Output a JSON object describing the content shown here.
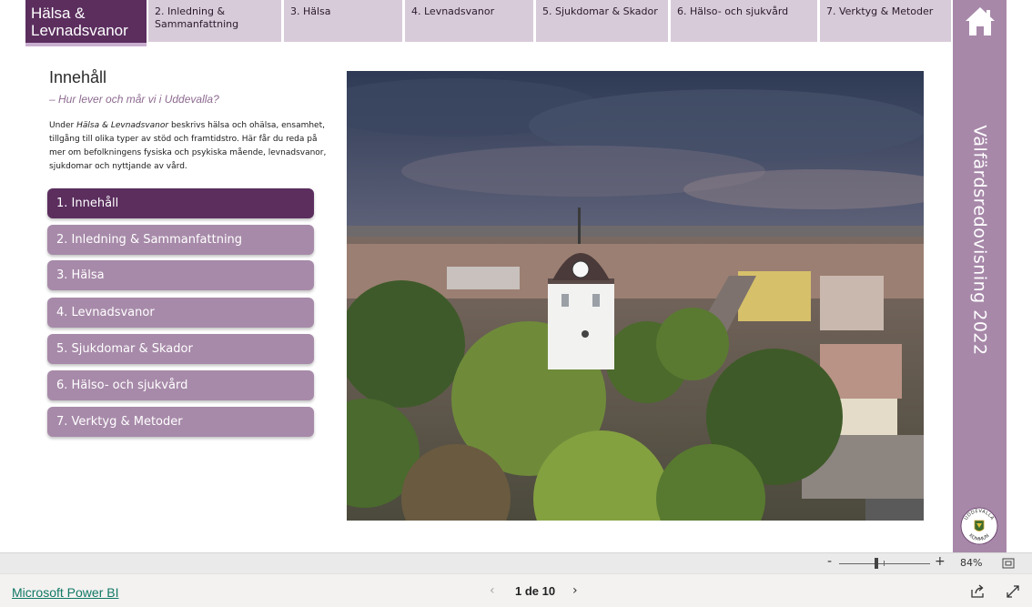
{
  "brand": {
    "line1": "Hälsa &",
    "line2": "Levnadsvanor"
  },
  "tabs": [
    {
      "line1": "2. Inledning &",
      "line2": "Sammanfattning"
    },
    {
      "line1": "3. Hälsa",
      "line2": ""
    },
    {
      "line1": "4. Levnadsvanor",
      "line2": ""
    },
    {
      "line1": "5. Sjukdomar & Skador",
      "line2": ""
    },
    {
      "line1": "6. Hälso- och sjukvård",
      "line2": ""
    },
    {
      "line1": "7. Verktyg & Metoder",
      "line2": ""
    }
  ],
  "home_icon": "home-icon",
  "sidebar": {
    "title": "Välfärdsredovisning 2022",
    "seal_top_text": "UDDEVALLA",
    "seal_bottom_text": "KOMMUN"
  },
  "content": {
    "title": "Innehåll",
    "subtitle": "– Hur lever och mår vi i Uddevalla?",
    "desc_prefix": "Under ",
    "desc_emphasis": "Hälsa & Levnadsvanor",
    "desc_rest": " beskrivs hälsa och ohälsa, ensamhet, tillgång till olika typer av stöd och framtidstro. Här får du reda på mer om befolkningens fysiska och psykiska mående, levnadsvanor, sjukdomar och nyttjande av vård."
  },
  "menu": [
    {
      "label": "1. Innehåll",
      "active": true
    },
    {
      "label": "2. Inledning & Sammanfattning",
      "active": false
    },
    {
      "label": "3. Hälsa",
      "active": false
    },
    {
      "label": "4. Levnadsvanor",
      "active": false
    },
    {
      "label": "5. Sjukdomar & Skador",
      "active": false
    },
    {
      "label": "6. Hälso- och sjukvård",
      "active": false
    },
    {
      "label": "7. Verktyg & Metoder",
      "active": false
    }
  ],
  "zoom": {
    "minus": "-",
    "plus": "+",
    "percent": "84%",
    "level": 0.84
  },
  "footer": {
    "app_link": "Microsoft Power BI",
    "page_label": "1 de 10",
    "prev": "‹",
    "next": "›"
  },
  "colors": {
    "brand_purple": "#5b2e5e",
    "menu_inactive": "#a78aa9",
    "tab_bg": "#d8cbd9",
    "sidebar": "#a788a9"
  }
}
